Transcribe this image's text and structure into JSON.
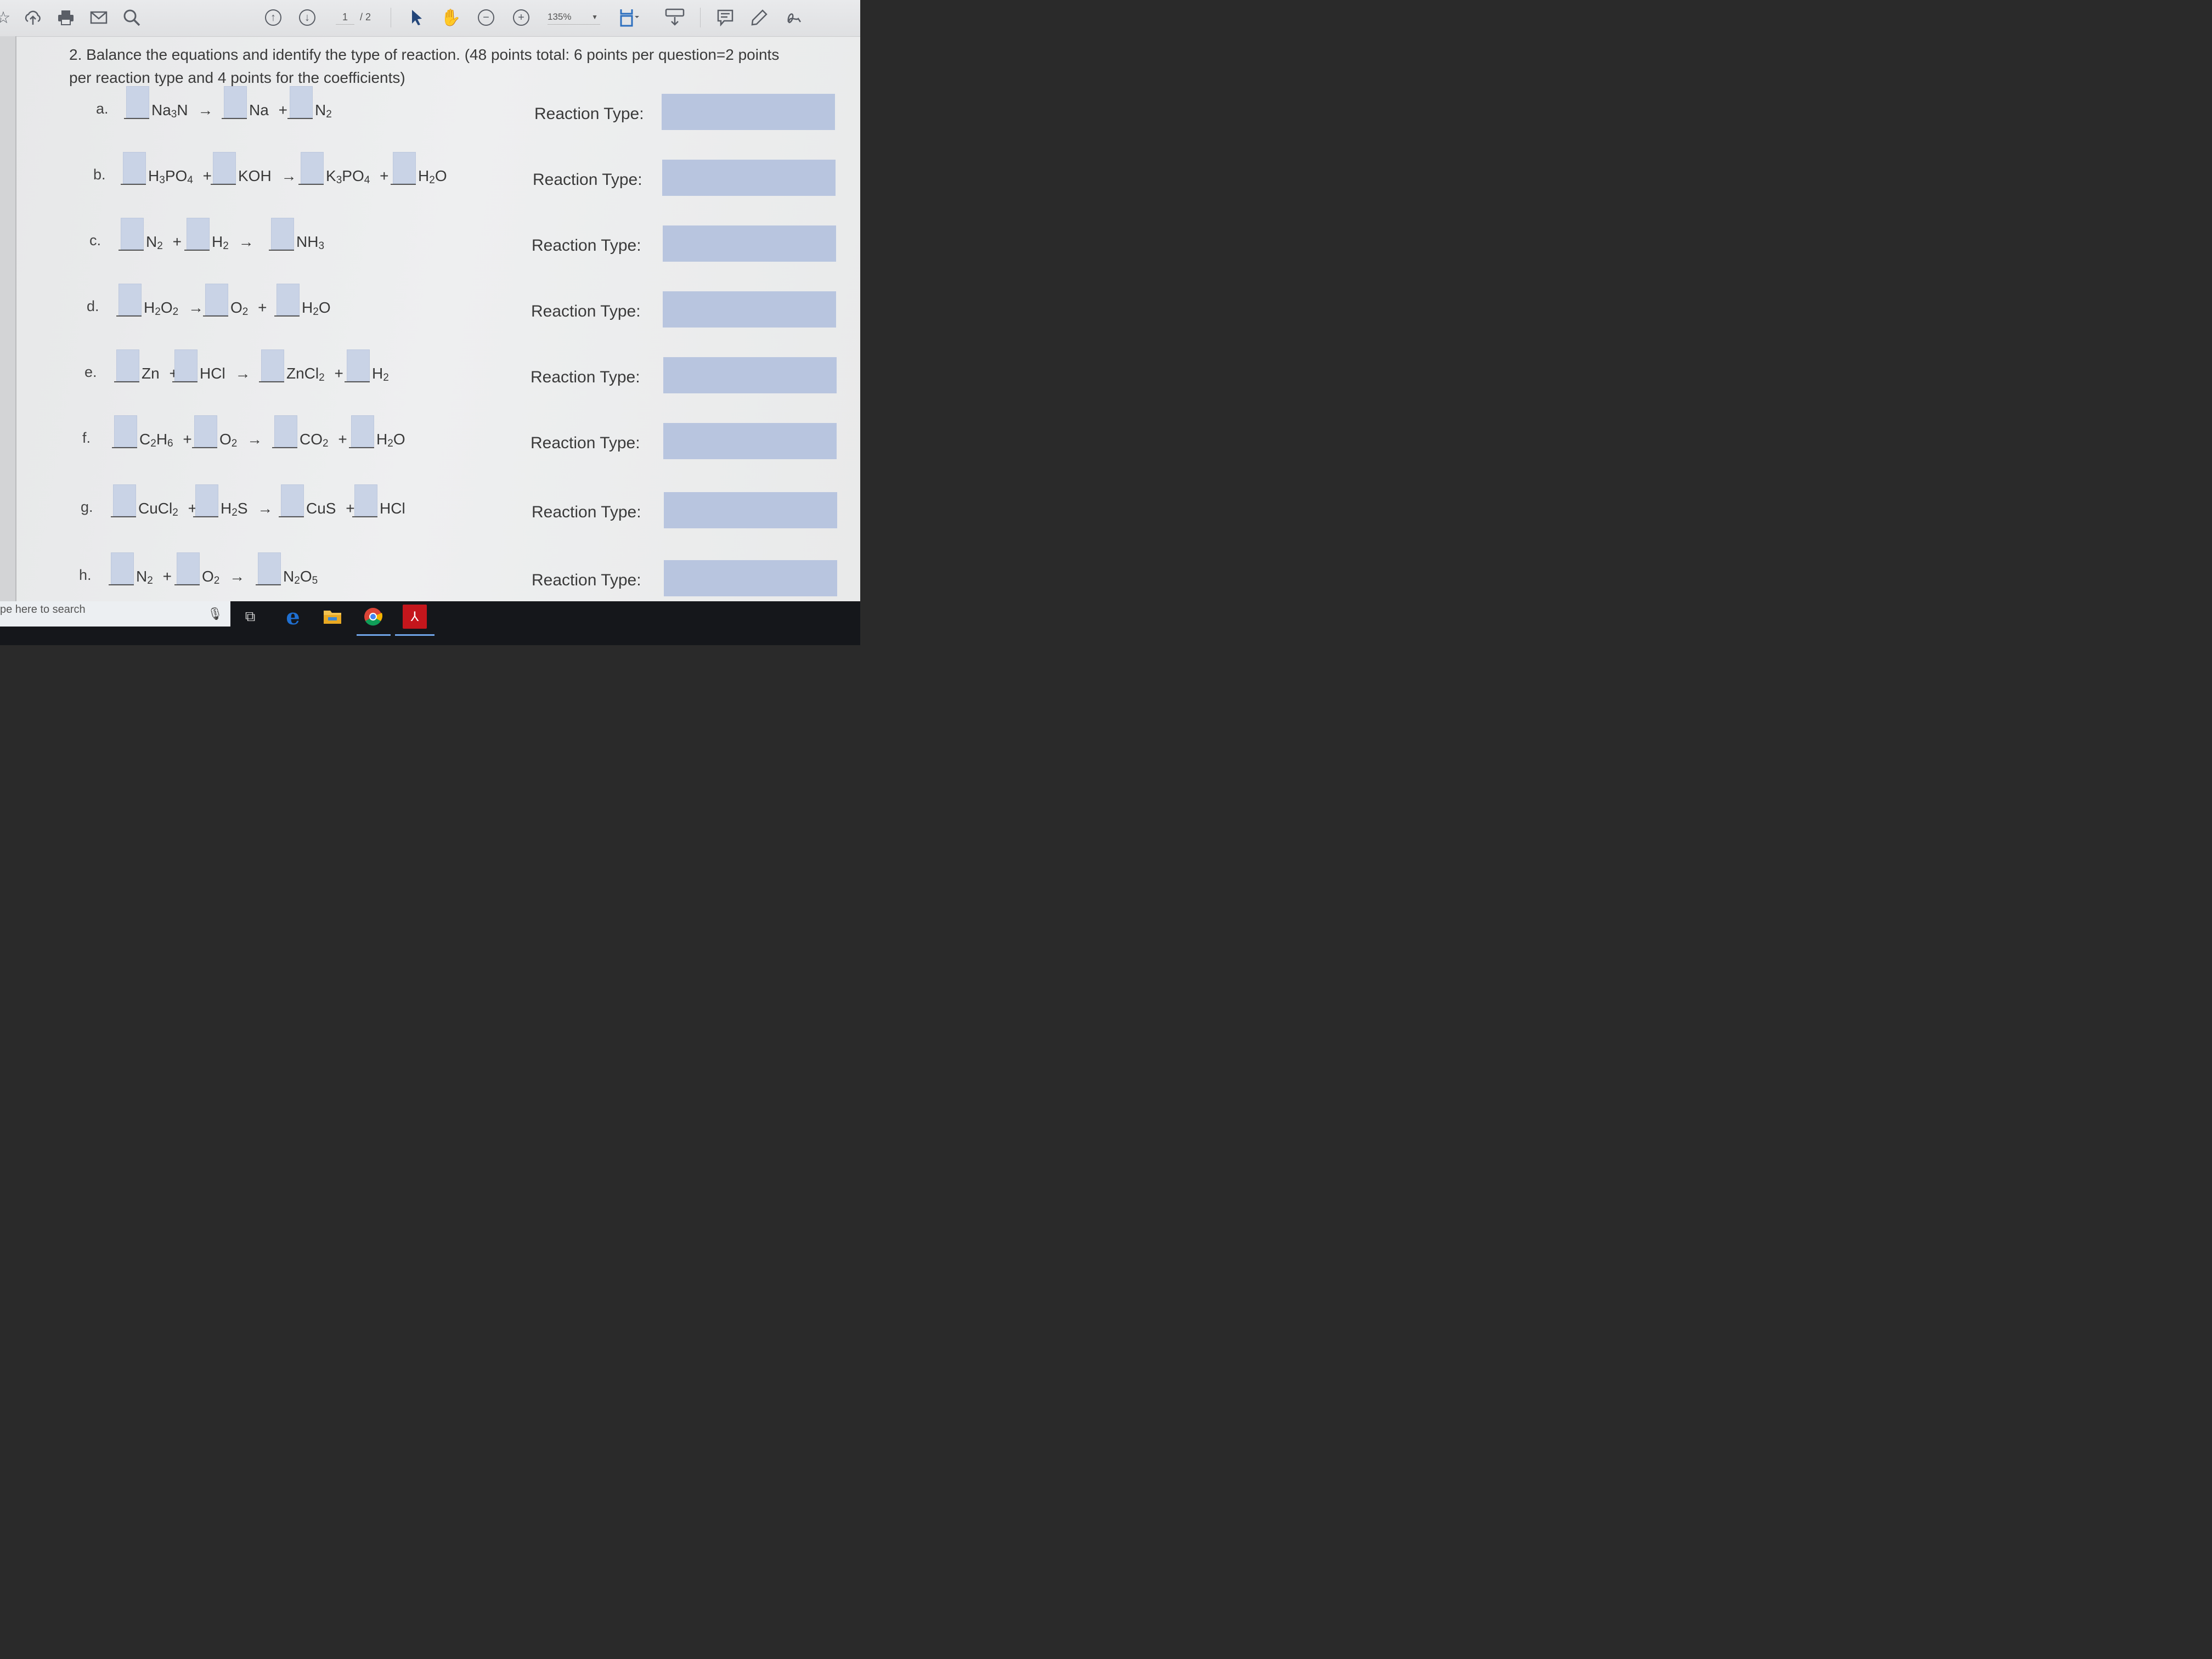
{
  "toolbar": {
    "page_current": "1",
    "page_total": "/ 2",
    "zoom": "135%"
  },
  "worksheet": {
    "heading": "2. Balance the equations and identify the type of reaction. (48 points total: 6 points per question=2 points per reaction type and 4 points for the coefficients)",
    "reaction_type_label": "Reaction Type:",
    "arrow": "→",
    "plus": "+",
    "rows": [
      {
        "letter": "a.",
        "terms": [
          "Na₃N",
          "Na",
          "N₂"
        ]
      },
      {
        "letter": "b.",
        "terms": [
          "H₃PO₄",
          "KOH",
          "K₃PO₄",
          "H₂O"
        ]
      },
      {
        "letter": "c.",
        "terms": [
          "N₂",
          "H₂",
          "NH₃"
        ]
      },
      {
        "letter": "d.",
        "terms": [
          "H₂O₂",
          "O₂",
          "H₂O"
        ]
      },
      {
        "letter": "e.",
        "terms": [
          "Zn",
          "HCl",
          "ZnCl₂",
          "H₂"
        ]
      },
      {
        "letter": "f.",
        "terms": [
          "C₂H₆",
          "O₂",
          "CO₂",
          "H₂O"
        ]
      },
      {
        "letter": "g.",
        "terms": [
          "CuCl₂",
          "H₂S",
          "CuS",
          "HCl"
        ]
      },
      {
        "letter": "h.",
        "terms": [
          "N₂",
          "O₂",
          "N₂O₅"
        ]
      }
    ]
  },
  "taskbar": {
    "search_placeholder": "pe here to search"
  },
  "colors": {
    "form_field": "#c9d3e6",
    "reaction_field": "#b8c5df",
    "taskbar": "#15171b",
    "edge_blue": "#1f6fd1",
    "acrobat_red": "#c4161c"
  }
}
